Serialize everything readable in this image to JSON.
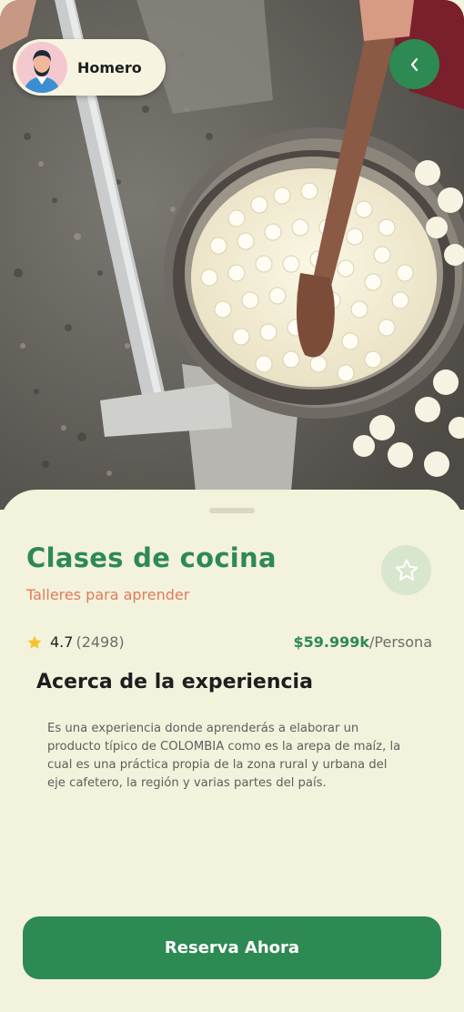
{
  "profile": {
    "name": "Homero",
    "avatar_icon": "man-avatar-icon"
  },
  "navigation": {
    "back_icon": "chevron-left-icon"
  },
  "experience": {
    "title": "Clases de cocina",
    "category": "Talleres para aprender",
    "rating": "4.7",
    "reviews_count": "(2498)",
    "price": "$59.999k",
    "price_unit": "/Persona",
    "about_heading": "Acerca de la experiencia",
    "description": "Es una experiencia donde aprenderás a elaborar un producto típico de COLOMBIA como es la arepa de maíz, la cual es una práctica propia de la zona rural y urbana del eje cafetero, la región y varias partes del país."
  },
  "actions": {
    "reserve_label": "Reserva Ahora",
    "favorite_icon": "star-outline-icon"
  },
  "colors": {
    "primary": "#2d8a52",
    "accent": "#e07b5c",
    "background": "#f3f2dc",
    "star": "#f4c430"
  }
}
